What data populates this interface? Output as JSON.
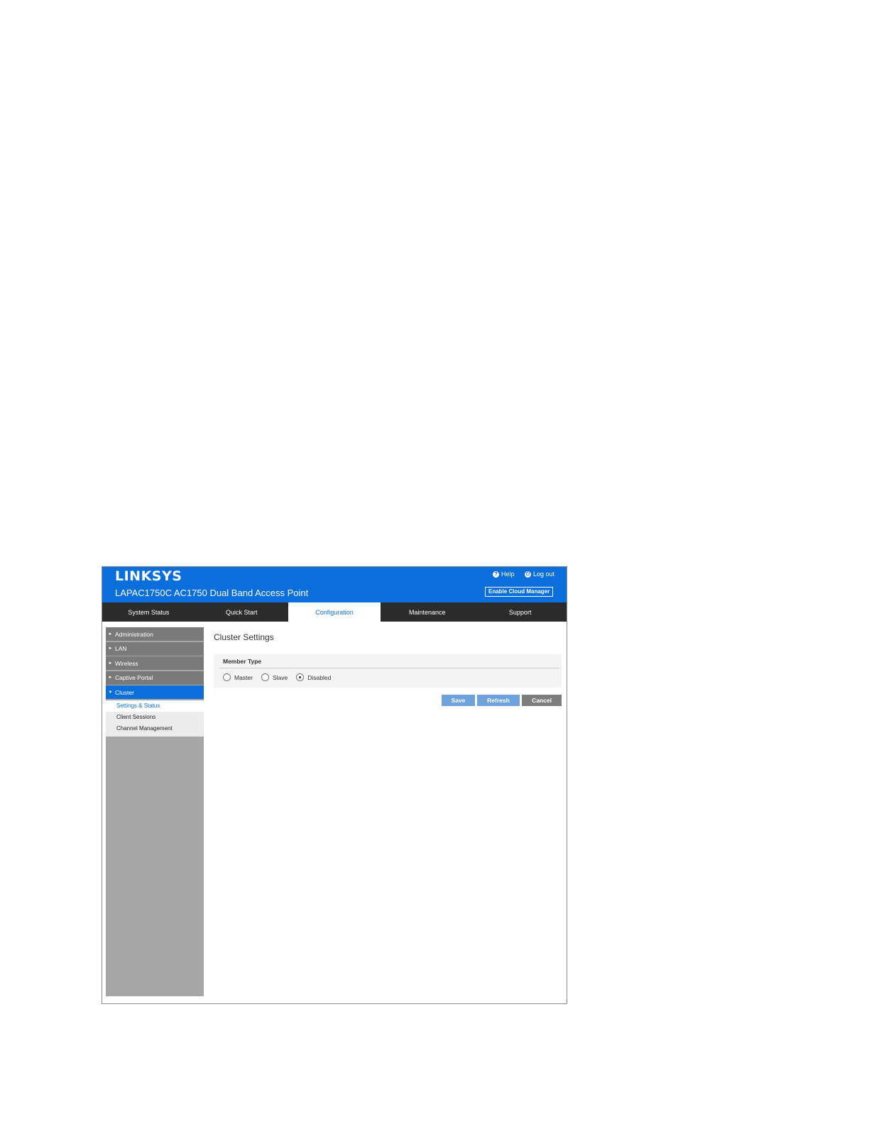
{
  "header": {
    "logo": "LINKSYS",
    "product": "LAPAC1750C AC1750 Dual Band Access Point",
    "help_label": "Help",
    "logout_label": "Log out",
    "cloud_button": "Enable Cloud Manager",
    "help_icon": "question-circle-icon",
    "logout_icon": "power-icon"
  },
  "tabs": [
    "System Status",
    "Quick Start",
    "Configuration",
    "Maintenance",
    "Support"
  ],
  "active_tab": "Configuration",
  "sidebar": {
    "items": [
      "Administration",
      "LAN",
      "Wireless",
      "Captive Portal",
      "Cluster"
    ],
    "active": "Cluster",
    "subitems": [
      "Settings & Status",
      "Client Sessions",
      "Channel Management"
    ],
    "active_sub": "Settings & Status"
  },
  "main": {
    "title": "Cluster Settings",
    "member_type_label": "Member Type",
    "options": [
      "Master",
      "Slave",
      "Disabled"
    ],
    "selected": "Disabled"
  },
  "buttons": {
    "save": "Save",
    "refresh": "Refresh",
    "cancel": "Cancel"
  },
  "colors": {
    "brand_blue": "#0a6fdc",
    "tab_bar": "#2b2b2b",
    "sidebar_item": "#7a7a7a",
    "button_blue": "#6ea2dd",
    "button_gray": "#7d7d7d"
  }
}
